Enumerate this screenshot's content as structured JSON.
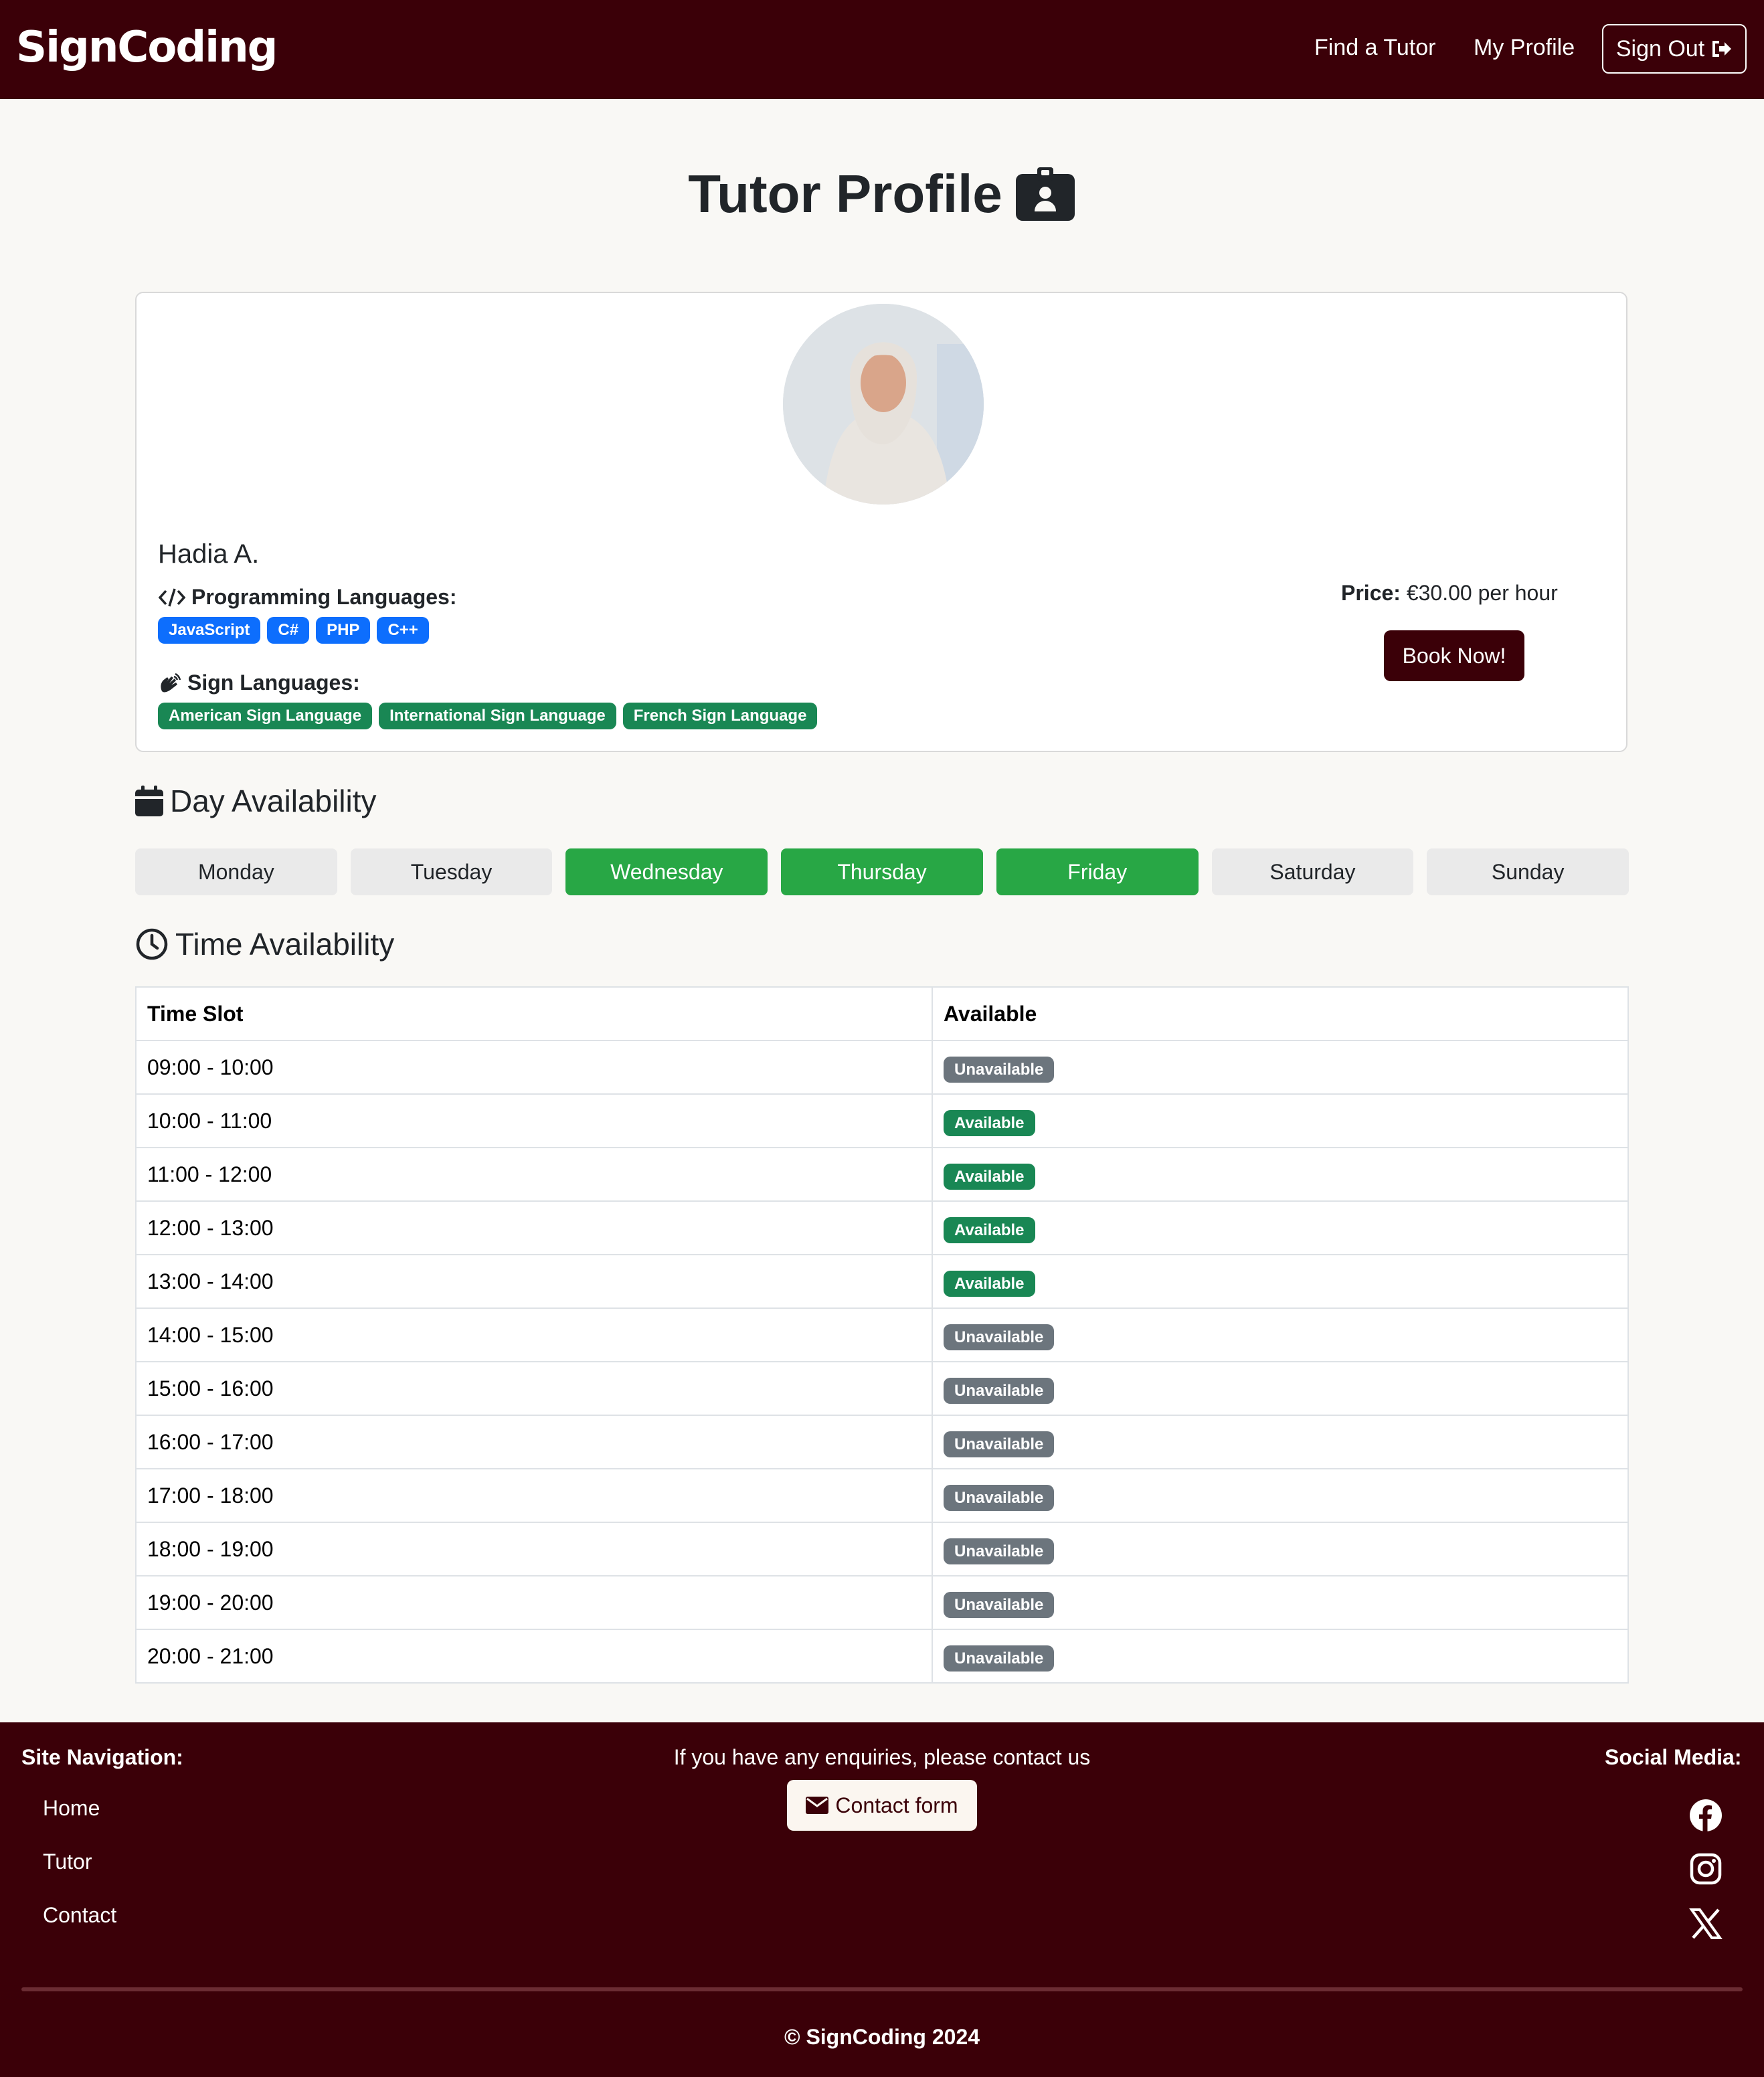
{
  "navbar": {
    "brand": "SignCoding",
    "find_tutor": "Find a Tutor",
    "my_profile": "My Profile",
    "sign_out": "Sign Out"
  },
  "page": {
    "title": "Tutor Profile"
  },
  "tutor": {
    "name": "Hadia A.",
    "programming_label": "Programming Languages:",
    "programming_languages": [
      "JavaScript",
      "C#",
      "PHP",
      "C++"
    ],
    "sign_label": "Sign Languages:",
    "sign_languages": [
      "American Sign Language",
      "International Sign Language",
      "French Sign Language"
    ],
    "price_label": "Price:",
    "price_value": "€30.00 per hour",
    "book_button": "Book Now!"
  },
  "day_availability": {
    "heading": "Day Availability",
    "days": [
      {
        "label": "Monday",
        "available": false
      },
      {
        "label": "Tuesday",
        "available": false
      },
      {
        "label": "Wednesday",
        "available": true
      },
      {
        "label": "Thursday",
        "available": true
      },
      {
        "label": "Friday",
        "available": true
      },
      {
        "label": "Saturday",
        "available": false
      },
      {
        "label": "Sunday",
        "available": false
      }
    ]
  },
  "time_availability": {
    "heading": "Time Availability",
    "col_time": "Time Slot",
    "col_available": "Available",
    "rows": [
      {
        "slot": "09:00 - 10:00",
        "status": "Unavailable"
      },
      {
        "slot": "10:00 - 11:00",
        "status": "Available"
      },
      {
        "slot": "11:00 - 12:00",
        "status": "Available"
      },
      {
        "slot": "12:00 - 13:00",
        "status": "Available"
      },
      {
        "slot": "13:00 - 14:00",
        "status": "Available"
      },
      {
        "slot": "14:00 - 15:00",
        "status": "Unavailable"
      },
      {
        "slot": "15:00 - 16:00",
        "status": "Unavailable"
      },
      {
        "slot": "16:00 - 17:00",
        "status": "Unavailable"
      },
      {
        "slot": "17:00 - 18:00",
        "status": "Unavailable"
      },
      {
        "slot": "18:00 - 19:00",
        "status": "Unavailable"
      },
      {
        "slot": "19:00 - 20:00",
        "status": "Unavailable"
      },
      {
        "slot": "20:00 - 21:00",
        "status": "Unavailable"
      }
    ]
  },
  "footer": {
    "site_nav_heading": "Site Navigation:",
    "links": [
      "Home",
      "Tutor",
      "Contact"
    ],
    "enquiries": "If you have any enquiries, please contact us",
    "contact_button": "Contact form",
    "social_heading": "Social Media:",
    "social_icons": [
      "facebook-icon",
      "instagram-icon",
      "x-icon"
    ],
    "copyright": "© SignCoding 2024"
  },
  "colors": {
    "brand": "#3b0008",
    "available_green": "#28a745",
    "badge_blue": "#0d6efd",
    "badge_green": "#198754",
    "unavailable_gray": "#6c757d"
  }
}
